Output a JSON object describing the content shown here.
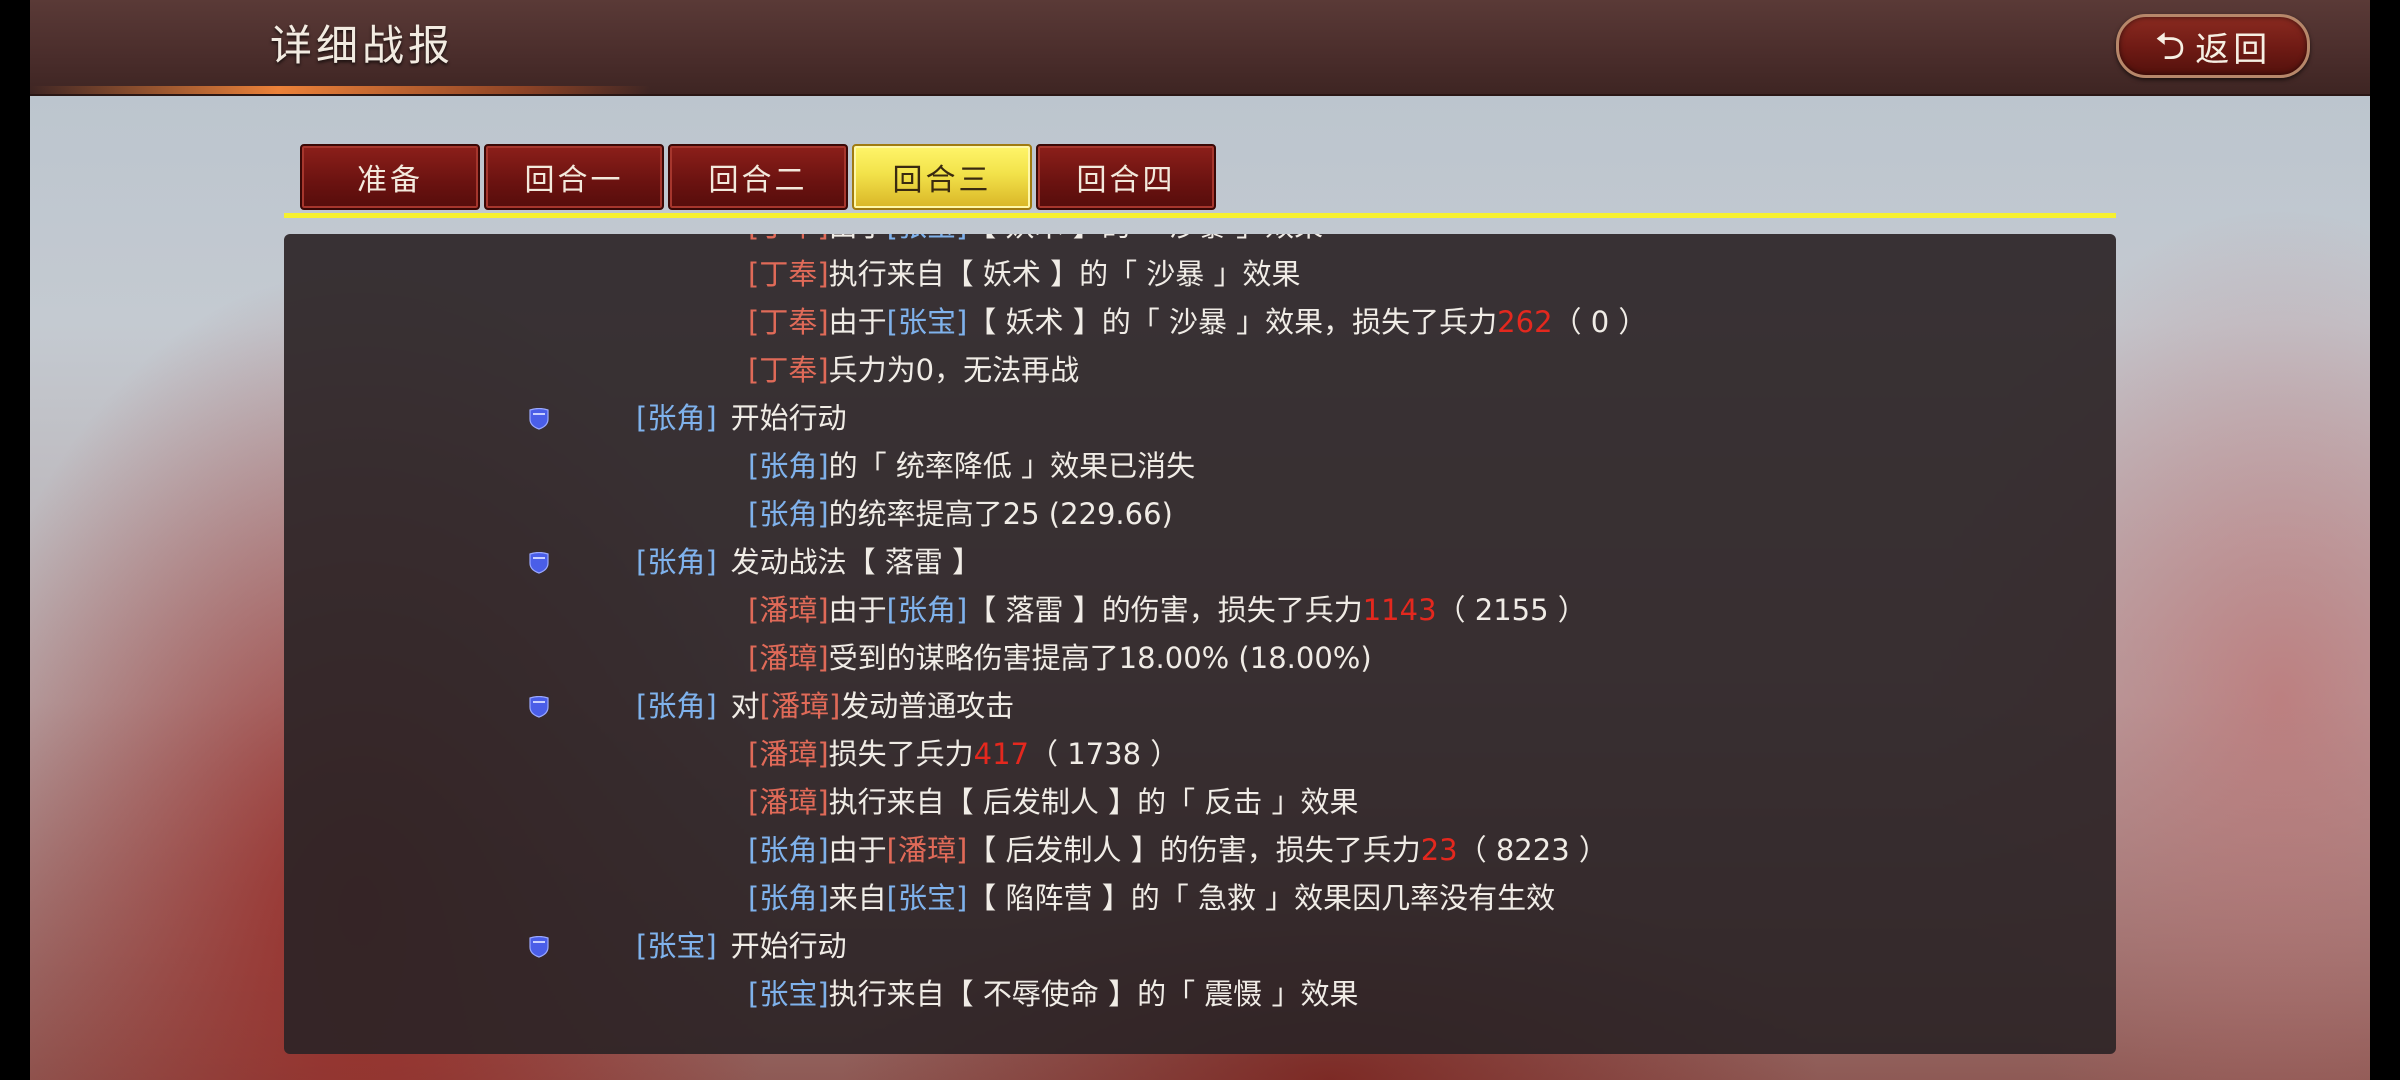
{
  "header": {
    "title": "详细战报",
    "back_label": "返回"
  },
  "tabs": [
    {
      "label": "准备",
      "active": false
    },
    {
      "label": "回合一",
      "active": false
    },
    {
      "label": "回合二",
      "active": false
    },
    {
      "label": "回合三",
      "active": true
    },
    {
      "label": "回合四",
      "active": false
    }
  ],
  "colors": {
    "ally_name": "#7fb2ec",
    "enemy_name": "#e06a58",
    "loss_number": "#e4281e",
    "active_tab": "#f2e24a",
    "tab_underline": "#f6f030"
  },
  "log": [
    {
      "kind": "sub",
      "parts": [
        {
          "t": "[丁奉]",
          "c": "red"
        },
        {
          "t": "由于"
        },
        {
          "t": "[张宝]",
          "c": "blue"
        },
        {
          "t": "【 妖术 】的「 沙暴 」效果"
        }
      ]
    },
    {
      "kind": "sub",
      "parts": [
        {
          "t": "[丁奉]",
          "c": "red"
        },
        {
          "t": "执行来自【 妖术 】的「 沙暴 」效果"
        }
      ]
    },
    {
      "kind": "sub",
      "parts": [
        {
          "t": "[丁奉]",
          "c": "red"
        },
        {
          "t": "由于"
        },
        {
          "t": "[张宝]",
          "c": "blue"
        },
        {
          "t": "【 妖术 】的「 沙暴 」效果，损失了兵力"
        },
        {
          "t": "262",
          "c": "num"
        },
        {
          "t": "（ 0 ）"
        }
      ]
    },
    {
      "kind": "sub",
      "parts": [
        {
          "t": "[丁奉]",
          "c": "red"
        },
        {
          "t": "兵力为0，无法再战"
        }
      ]
    },
    {
      "kind": "main",
      "icon": "shield-icon",
      "actor": {
        "t": "[张角]",
        "c": "blue"
      },
      "parts": [
        {
          "t": "开始行动"
        }
      ]
    },
    {
      "kind": "sub",
      "parts": [
        {
          "t": "[张角]",
          "c": "blue"
        },
        {
          "t": "的「 统率降低 」效果已消失"
        }
      ]
    },
    {
      "kind": "sub",
      "parts": [
        {
          "t": "[张角]",
          "c": "blue"
        },
        {
          "t": "的统率提高了25 (229.66)"
        }
      ]
    },
    {
      "kind": "main",
      "icon": "shield-icon",
      "actor": {
        "t": "[张角]",
        "c": "blue"
      },
      "parts": [
        {
          "t": "发动战法【 落雷 】"
        }
      ]
    },
    {
      "kind": "sub",
      "parts": [
        {
          "t": "[潘璋]",
          "c": "red"
        },
        {
          "t": "由于"
        },
        {
          "t": "[张角]",
          "c": "blue"
        },
        {
          "t": "【 落雷 】的伤害，损失了兵力"
        },
        {
          "t": "1143",
          "c": "num"
        },
        {
          "t": "（ 2155 ）"
        }
      ]
    },
    {
      "kind": "sub",
      "parts": [
        {
          "t": "[潘璋]",
          "c": "red"
        },
        {
          "t": "受到的谋略伤害提高了18.00% (18.00%)"
        }
      ]
    },
    {
      "kind": "main",
      "icon": "shield-icon",
      "actor": {
        "t": "[张角]",
        "c": "blue"
      },
      "parts": [
        {
          "t": "对"
        },
        {
          "t": "[潘璋]",
          "c": "red"
        },
        {
          "t": "发动普通攻击"
        }
      ]
    },
    {
      "kind": "sub",
      "parts": [
        {
          "t": "[潘璋]",
          "c": "red"
        },
        {
          "t": "损失了兵力"
        },
        {
          "t": "417",
          "c": "num"
        },
        {
          "t": "（ 1738 ）"
        }
      ]
    },
    {
      "kind": "sub",
      "parts": [
        {
          "t": "[潘璋]",
          "c": "red"
        },
        {
          "t": "执行来自【 后发制人 】的「 反击 」效果"
        }
      ]
    },
    {
      "kind": "sub",
      "parts": [
        {
          "t": "[张角]",
          "c": "blue"
        },
        {
          "t": "由于"
        },
        {
          "t": "[潘璋]",
          "c": "red"
        },
        {
          "t": "【 后发制人 】的伤害，损失了兵力"
        },
        {
          "t": "23",
          "c": "num"
        },
        {
          "t": "（ 8223 ）"
        }
      ]
    },
    {
      "kind": "sub",
      "parts": [
        {
          "t": "[张角]",
          "c": "blue"
        },
        {
          "t": "来自"
        },
        {
          "t": "[张宝]",
          "c": "blue"
        },
        {
          "t": "【 陷阵营 】的「 急救 」效果因几率没有生效"
        }
      ]
    },
    {
      "kind": "main",
      "icon": "shield-icon",
      "actor": {
        "t": "[张宝]",
        "c": "blue"
      },
      "parts": [
        {
          "t": "开始行动"
        }
      ]
    },
    {
      "kind": "sub",
      "parts": [
        {
          "t": "[张宝]",
          "c": "blue"
        },
        {
          "t": "执行来自【 不辱使命 】的「 震慑 」效果"
        }
      ]
    }
  ]
}
